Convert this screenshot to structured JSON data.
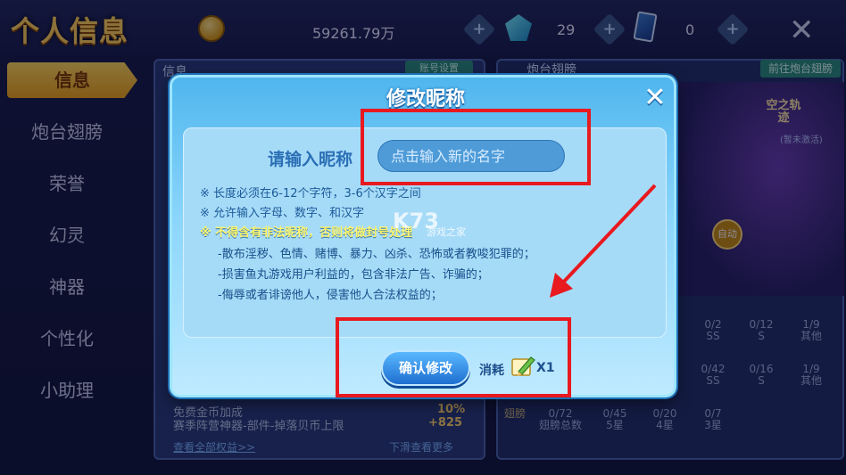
{
  "header": {
    "title": "个人信息",
    "coins": "59261.79万",
    "gems": "29",
    "cards": "0",
    "plus": "+",
    "close": "✕"
  },
  "sidebar": {
    "items": [
      {
        "label": "信息",
        "active": true
      },
      {
        "label": "炮台翅膀"
      },
      {
        "label": "荣誉"
      },
      {
        "label": "幻灵"
      },
      {
        "label": "神器"
      },
      {
        "label": "个性化"
      },
      {
        "label": "小助理"
      }
    ]
  },
  "left_panel": {
    "header": "信息",
    "tab_button": "账号设置",
    "rows": [
      {
        "label": "免费金币加成",
        "value": "10%"
      },
      {
        "label": "赛季阵营神器-部件-掉落贝币上限",
        "value": "+825"
      }
    ],
    "view_all": "查看全部权益>>",
    "scroll_more": "下滑查看更多"
  },
  "right_panel": {
    "header": "炮台翅膀",
    "goto_button": "前往炮台翅膀",
    "stage_title": "空之轨迹",
    "stage_sub": "(暂未激活)",
    "auto_label": "自动",
    "stats_row1": [
      {
        "n": "0/2",
        "t": "SS"
      },
      {
        "n": "0/12",
        "t": "S"
      },
      {
        "n": "1/9",
        "t": "其他"
      }
    ],
    "stats_row2": [
      {
        "n": "0/42",
        "t": "SS"
      },
      {
        "n": "0/16",
        "t": "S"
      },
      {
        "n": "1/9",
        "t": "其他"
      }
    ],
    "wing_label": "翅膀",
    "stats_row3": [
      {
        "n": "0/72",
        "t": "翅膀总数"
      },
      {
        "n": "0/45",
        "t": "5星"
      },
      {
        "n": "0/20",
        "t": "4星"
      },
      {
        "n": "0/7",
        "t": "3星"
      }
    ]
  },
  "modal": {
    "title": "修改昵称",
    "close": "✕",
    "input_label": "请输入昵称",
    "input_placeholder": "点击输入新的名字",
    "rules": [
      "※  长度必须在6-12个字符，3-6个汉字之间",
      "※  允许输入字母、数字、和汉字",
      "※  不得含有非法昵称，否则将做封号处理"
    ],
    "sub_rules": [
      "-散布淫秽、色情、赌博、暴力、凶杀、恐怖或者教唆犯罪的；",
      "-损害鱼丸游戏用户利益的，包含非法广告、诈骗的；",
      "-侮辱或者诽谤他人，侵害他人合法权益的；"
    ],
    "confirm": "确认修改",
    "cost_label": "消耗",
    "cost_count": "X1"
  },
  "watermark": {
    "logo": "K73",
    "sub": "游戏之家"
  },
  "colors": {
    "highlight": "#e8191f",
    "modal_blue": "#4fb6ee",
    "warn_yellow": "#fff66a"
  }
}
